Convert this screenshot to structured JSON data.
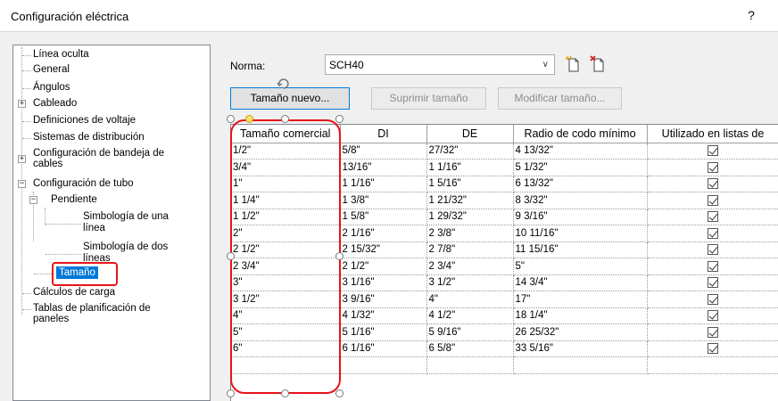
{
  "window": {
    "title": "Configuración eléctrica",
    "help": "?"
  },
  "tree": {
    "items": [
      {
        "label": "Línea oculta"
      },
      {
        "label": "General"
      },
      {
        "label": "Ángulos"
      },
      {
        "label": "Cableado",
        "expander": "+"
      },
      {
        "label": "Definiciones de voltaje"
      },
      {
        "label": "Sistemas de distribución"
      },
      {
        "label": "Configuración de bandeja de",
        "label2": "cables",
        "expander": "+"
      },
      {
        "label": "Configuración de tubo",
        "expander": "−"
      },
      {
        "label": "Pendiente",
        "expander": "−"
      },
      {
        "label": "Simbología de una",
        "label2": "línea"
      },
      {
        "label": "Simbología de dos",
        "label2": "líneas"
      },
      {
        "label": "Tamaño",
        "selected": true
      },
      {
        "label": "Cálculos de carga"
      },
      {
        "label": "Tablas de planificación de",
        "label2": "paneles"
      }
    ]
  },
  "norma": {
    "label": "Norma:",
    "value": "SCH40"
  },
  "icons": {
    "new_type": "new-type-icon",
    "delete_type": "delete-type-icon",
    "rotate": "rotate-handle-icon"
  },
  "buttons": {
    "new_size": "Tamaño nuevo...",
    "delete_size": "Suprimir tamaño",
    "modify_size": "Modificar tamaño..."
  },
  "table": {
    "headers": [
      "Tamaño comercial",
      "DI",
      "DE",
      "Radio de codo mínimo",
      "Utilizado en listas de"
    ],
    "rows": [
      [
        "1/2\"",
        "5/8\"",
        "27/32\"",
        "4 13/32\""
      ],
      [
        "3/4\"",
        "13/16\"",
        "1 1/16\"",
        "5 1/32\""
      ],
      [
        "1\"",
        "1 1/16\"",
        "1 5/16\"",
        "6 13/32\""
      ],
      [
        "1 1/4\"",
        "1 3/8\"",
        "1 21/32\"",
        "8 3/32\""
      ],
      [
        "1 1/2\"",
        "1 5/8\"",
        "1 29/32\"",
        "9 3/16\""
      ],
      [
        "2\"",
        "2 1/16\"",
        "2 3/8\"",
        "10 11/16\""
      ],
      [
        "2 1/2\"",
        "2 15/32\"",
        "2 7/8\"",
        "11 15/16\""
      ],
      [
        "2 3/4\"",
        "2 1/2\"",
        "2 3/4\"",
        "5\""
      ],
      [
        "3\"",
        "3 1/16\"",
        "3 1/2\"",
        "14 3/4\""
      ],
      [
        "3 1/2\"",
        "3 9/16\"",
        "4\"",
        "17\""
      ],
      [
        "4\"",
        "4 1/32\"",
        "4 1/2\"",
        "18 1/4\""
      ],
      [
        "5\"",
        "5 1/16\"",
        "5 9/16\"",
        "26 25/32\""
      ],
      [
        "6\"",
        "6 1/16\"",
        "6 5/8\"",
        "33 5/16\""
      ]
    ],
    "used_checked": true
  },
  "colors": {
    "highlight": "#e8131a",
    "selection": "#0078d7"
  }
}
